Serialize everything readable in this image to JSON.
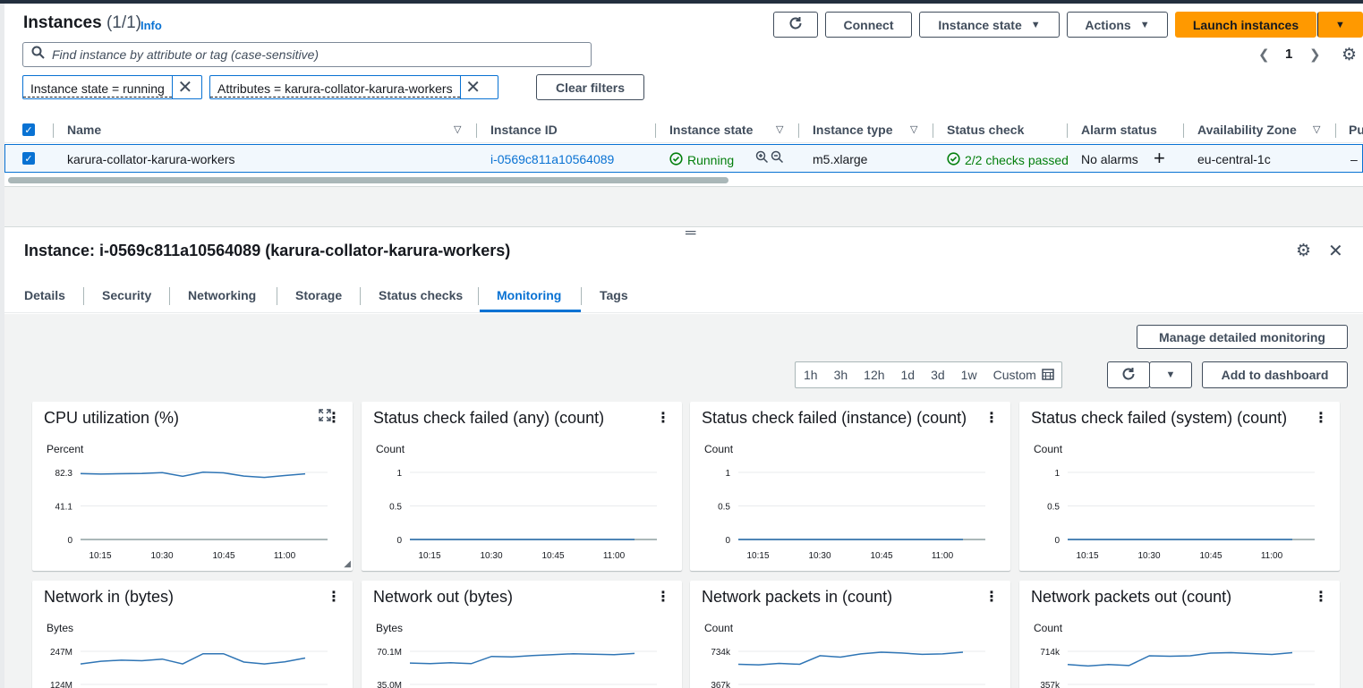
{
  "header": {
    "title": "Instances",
    "count": "(1/1)",
    "info": "Info",
    "buttons": {
      "connect": "Connect",
      "instance_state": "Instance state",
      "actions": "Actions",
      "launch": "Launch instances"
    },
    "search_placeholder": "Find instance by attribute or tag (case-sensitive)",
    "page": "1",
    "filters": [
      "Instance state = running",
      "Attributes = karura-collator-karura-workers"
    ],
    "clear_filters": "Clear filters"
  },
  "table": {
    "columns": [
      "Name",
      "Instance ID",
      "Instance state",
      "Instance type",
      "Status check",
      "Alarm status",
      "Availability Zone",
      "Pu"
    ],
    "row": {
      "name": "karura-collator-karura-workers",
      "instance_id": "i-0569c811a10564089",
      "state": "Running",
      "type": "m5.xlarge",
      "status_check": "2/2 checks passed",
      "alarm": "No alarms",
      "az": "eu-central-1c",
      "public": "–"
    }
  },
  "details": {
    "title": "Instance: i-0569c811a10564089 (karura-collator-karura-workers)",
    "tabs": [
      "Details",
      "Security",
      "Networking",
      "Storage",
      "Status checks",
      "Monitoring",
      "Tags"
    ],
    "active_tab": "Monitoring"
  },
  "monitoring": {
    "manage_button": "Manage detailed monitoring",
    "ranges": [
      "1h",
      "3h",
      "12h",
      "1d",
      "3d",
      "1w",
      "Custom"
    ],
    "add_to_dashboard": "Add to dashboard",
    "line_color": "#2f75b5"
  },
  "chart_data": [
    {
      "type": "line",
      "title": "CPU utilization (%)",
      "ylabel": "Percent",
      "yticks": [
        "82.3",
        "41.1",
        "0"
      ],
      "ylim": [
        0,
        82.3
      ],
      "xticks": [
        "10:15",
        "10:30",
        "10:45",
        "11:00"
      ],
      "series": [
        {
          "values": [
            80.8,
            80.2,
            80.6,
            81.0,
            82.0,
            77.5,
            82.5,
            81.8,
            77.8,
            76.2,
            78.5,
            80.5
          ]
        }
      ]
    },
    {
      "type": "line",
      "title": "Status check failed (any) (count)",
      "ylabel": "Count",
      "yticks": [
        "1",
        "0.5",
        "0"
      ],
      "ylim": [
        0,
        1
      ],
      "xticks": [
        "10:15",
        "10:30",
        "10:45",
        "11:00"
      ],
      "series": [
        {
          "values": [
            0,
            0,
            0,
            0,
            0,
            0,
            0,
            0,
            0,
            0,
            0,
            0
          ]
        }
      ]
    },
    {
      "type": "line",
      "title": "Status check failed (instance) (count)",
      "ylabel": "Count",
      "yticks": [
        "1",
        "0.5",
        "0"
      ],
      "ylim": [
        0,
        1
      ],
      "xticks": [
        "10:15",
        "10:30",
        "10:45",
        "11:00"
      ],
      "series": [
        {
          "values": [
            0,
            0,
            0,
            0,
            0,
            0,
            0,
            0,
            0,
            0,
            0,
            0
          ]
        }
      ]
    },
    {
      "type": "line",
      "title": "Status check failed (system) (count)",
      "ylabel": "Count",
      "yticks": [
        "1",
        "0.5",
        "0"
      ],
      "ylim": [
        0,
        1
      ],
      "xticks": [
        "10:15",
        "10:30",
        "10:45",
        "11:00"
      ],
      "series": [
        {
          "values": [
            0,
            0,
            0,
            0,
            0,
            0,
            0,
            0,
            0,
            0,
            0,
            0
          ]
        }
      ]
    },
    {
      "type": "line",
      "title": "Network in (bytes)",
      "ylabel": "Bytes",
      "yticks": [
        "247M",
        "124M"
      ],
      "ylim": [
        124,
        247
      ],
      "xticks": [],
      "series": [
        {
          "values": [
            200,
            210,
            214,
            212,
            218,
            200,
            238,
            238,
            207,
            200,
            208,
            222
          ]
        }
      ]
    },
    {
      "type": "line",
      "title": "Network out (bytes)",
      "ylabel": "Bytes",
      "yticks": [
        "70.1M",
        "35.0M"
      ],
      "ylim": [
        35.0,
        70.1
      ],
      "xticks": [],
      "series": [
        {
          "values": [
            57.7,
            57.0,
            58.0,
            57.0,
            64.7,
            64.2,
            65.5,
            66.6,
            67.5,
            67.0,
            66.5,
            67.8
          ]
        }
      ]
    },
    {
      "type": "line",
      "title": "Network packets in (count)",
      "ylabel": "Count",
      "yticks": [
        "734k",
        "367k"
      ],
      "ylim": [
        367,
        734
      ],
      "xticks": [],
      "series": [
        {
          "values": [
            590,
            584,
            600,
            590,
            685,
            670,
            705,
            724,
            715,
            700,
            705,
            724
          ]
        }
      ]
    },
    {
      "type": "line",
      "title": "Network packets out (count)",
      "ylabel": "Count",
      "yticks": [
        "714k",
        "357k"
      ],
      "ylim": [
        357,
        714
      ],
      "xticks": [],
      "series": [
        {
          "values": [
            571,
            556,
            571,
            561,
            666,
            661,
            666,
            695,
            700,
            690,
            680,
            700
          ]
        }
      ]
    }
  ]
}
